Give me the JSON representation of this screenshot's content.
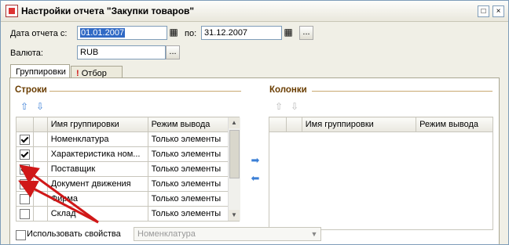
{
  "window": {
    "title": "Настройки отчета \"Закупки товаров\"",
    "icon": "report-icon",
    "controls": {
      "maximize": "□",
      "close": "×"
    }
  },
  "form": {
    "date_label": "Дата отчета с:",
    "date_from": "01.01.2007",
    "po_label": "по:",
    "date_to": "31.12.2007",
    "currency_label": "Валюта:",
    "currency": "RUB",
    "ellipsis": "..."
  },
  "tabs": [
    {
      "label": "Группировки",
      "active": true
    },
    {
      "label": "Отбор",
      "active": false,
      "marker": "!"
    }
  ],
  "rows_section": {
    "title": "Строки",
    "columns": [
      "",
      "Имя группировки",
      "Режим вывода"
    ],
    "items": [
      {
        "checked": true,
        "name": "Номенклатура",
        "mode": "Только элементы"
      },
      {
        "checked": true,
        "name": "Характеристика ном...",
        "mode": "Только элементы"
      },
      {
        "checked": true,
        "name": "Поставщик",
        "mode": "Только элементы"
      },
      {
        "checked": true,
        "name": "Документ движения",
        "mode": "Только элементы"
      },
      {
        "checked": false,
        "name": "Фирма",
        "mode": "Только элементы"
      },
      {
        "checked": false,
        "name": "Склад",
        "mode": "Только элементы"
      }
    ]
  },
  "columns_section": {
    "title": "Колонки",
    "columns": [
      "",
      "Имя группировки",
      "Режим вывода"
    ]
  },
  "use_properties": {
    "label": "Использовать свойства",
    "checked": false,
    "combo_value": "Номенклатура"
  },
  "colors": {
    "accent_title": "#6a3d00",
    "selection": "#316ac5",
    "arrow_red": "#d01818"
  }
}
